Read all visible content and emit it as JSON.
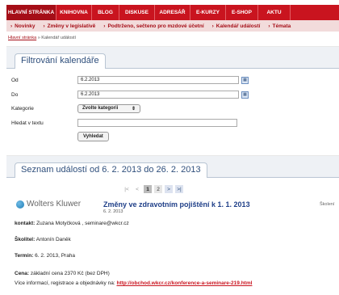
{
  "topnav": [
    {
      "label": "HLAVNÍ STRÁNKA",
      "active": true
    },
    {
      "label": "KNIHOVNA"
    },
    {
      "label": "BLOG"
    },
    {
      "label": "DISKUSE"
    },
    {
      "label": "ADRESÁŘ"
    },
    {
      "label": "E-KURZY"
    },
    {
      "label": "E-SHOP"
    },
    {
      "label": "AKTU"
    }
  ],
  "subnav": [
    "Novinky",
    "Změny v legislativě",
    "Podtrženo, sečteno pro mzdové účetní",
    "Kalendář událostí",
    "Témata"
  ],
  "breadcrumb": {
    "home": "Hlavní stránka",
    "separator": "»",
    "current": "Kalendář událostí"
  },
  "filter": {
    "title": "Filtrování kalendáře",
    "from_label": "Od",
    "from_value": "6.2.2013",
    "to_label": "Do",
    "to_value": "6.2.2013",
    "category_label": "Kategorie",
    "category_value": "Zvolte kategorii",
    "search_label": "Hledat v textu",
    "search_value": "",
    "search_button": "Vyhledat"
  },
  "events": {
    "title": "Seznam událostí od 6. 2. 2013 do 26. 2. 2013",
    "pager": {
      "first": "|<",
      "prev": "<",
      "pages": [
        "1",
        "2"
      ],
      "next": ">",
      "last": ">|"
    },
    "logo_text": "Wolters Kluwer",
    "item": {
      "title": "Změny ve zdravotním pojištění k 1. 1. 2013",
      "date": "6. 2. 2013",
      "side": "Školení",
      "contact_label": "kontakt:",
      "contact_value": "Zuzana Motyčková , seminare@wkcr.cz",
      "trainer_label": "Školitel:",
      "trainer_value": "Antonín Daněk",
      "term_label": "Termín:",
      "term_value": "6. 2. 2013, Praha",
      "price_label": "Cena:",
      "price_value": "základní cena 2370 Kč (bez DPH)",
      "more_text": "Více informací, registrace a objednávky na:",
      "more_link": "http://obchod.wkcr.cz/konference-a-seminare-219.html"
    }
  },
  "colors": {
    "brand_red": "#c9141f",
    "panel_blue": "#2f4f7c",
    "link_blue": "#1f3f88"
  }
}
